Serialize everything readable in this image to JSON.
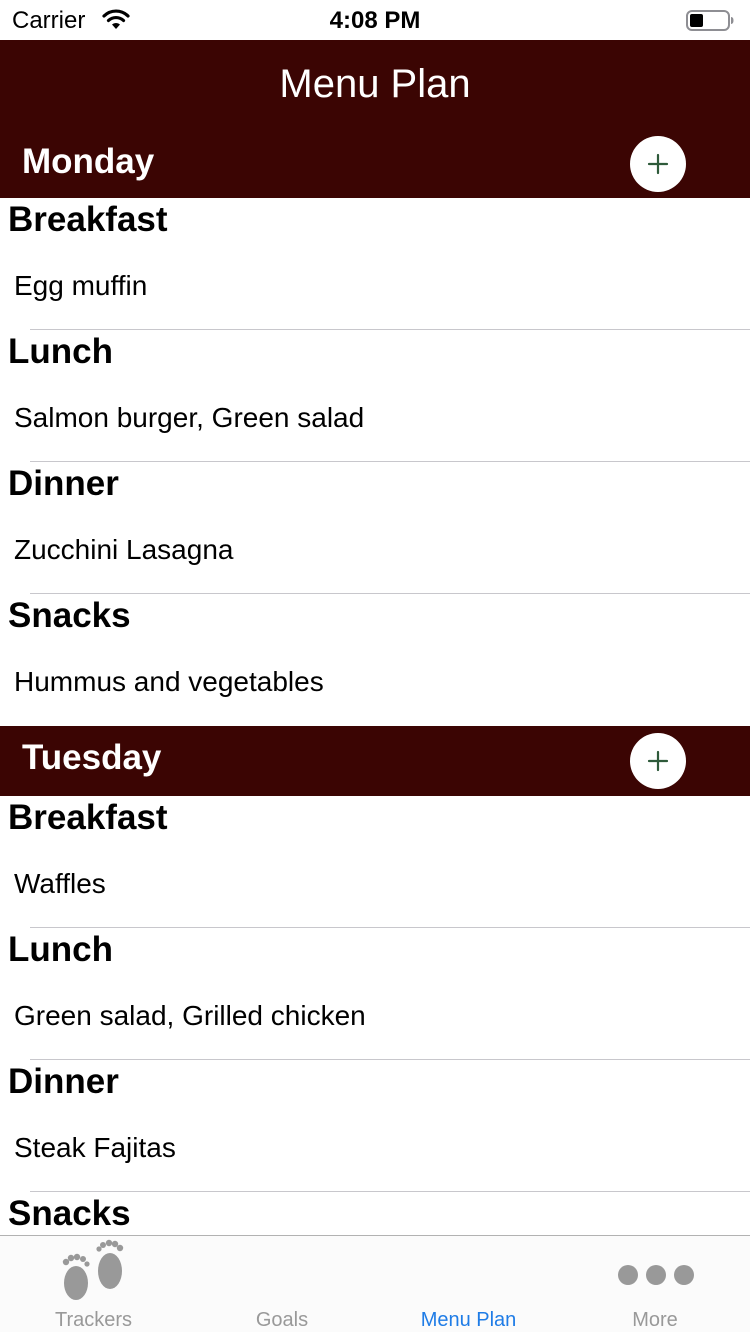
{
  "status_bar": {
    "carrier": "Carrier",
    "time": "4:08 PM",
    "icons": [
      "wifi-icon",
      "battery-icon"
    ]
  },
  "nav": {
    "title": "Menu Plan"
  },
  "days": [
    {
      "name": "Monday",
      "meals": [
        {
          "title": "Breakfast",
          "items": "Egg muffin"
        },
        {
          "title": "Lunch",
          "items": "Salmon burger, Green salad"
        },
        {
          "title": "Dinner",
          "items": "Zucchini Lasagna"
        },
        {
          "title": "Snacks",
          "items": "Hummus and vegetables"
        }
      ]
    },
    {
      "name": "Tuesday",
      "meals": [
        {
          "title": "Breakfast",
          "items": "Waffles"
        },
        {
          "title": "Lunch",
          "items": "Green salad, Grilled chicken"
        },
        {
          "title": "Dinner",
          "items": "Steak Fajitas"
        },
        {
          "title": "Snacks",
          "items": ""
        }
      ]
    }
  ],
  "tabs": [
    {
      "label": "Trackers",
      "icon": "footprints-icon",
      "active": false
    },
    {
      "label": "Goals",
      "icon": "",
      "active": false
    },
    {
      "label": "Menu Plan",
      "icon": "",
      "active": true
    },
    {
      "label": "More",
      "icon": "more-dots-icon",
      "active": false
    }
  ],
  "colors": {
    "header_bg": "#3b0503",
    "plus_icon": "#2e5a3a",
    "tab_active": "#1f7ce6",
    "tab_inactive": "#999999"
  }
}
